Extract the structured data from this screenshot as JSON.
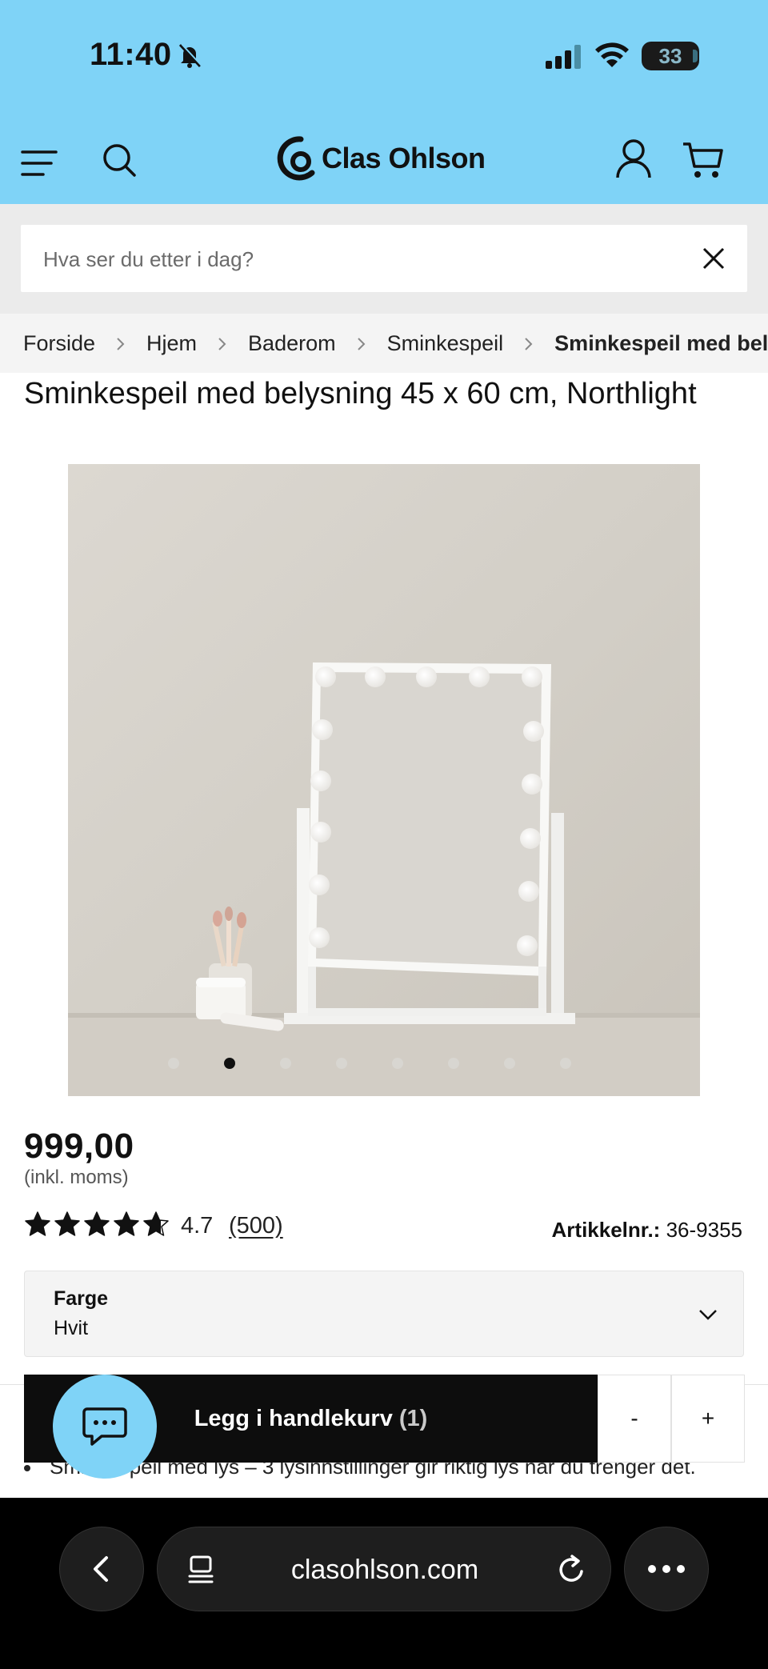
{
  "status_bar": {
    "time": "11:40",
    "battery": "33"
  },
  "header": {
    "logo_text": "Clas Ohlson",
    "background_color": "#7fd3f7"
  },
  "search": {
    "placeholder": "Hva ser du etter i dag?"
  },
  "breadcrumb": {
    "items": [
      "Forside",
      "Hjem",
      "Baderom",
      "Sminkespeil"
    ],
    "current": "Sminkespeil med belysning"
  },
  "product": {
    "title": "Sminkespeil med belysning 45 x 60 cm, Northlight",
    "image_count": 8,
    "active_image": 2,
    "price": "999,00",
    "vat_note": "(inkl. moms)",
    "rating": "4.7",
    "rating_value": 4.7,
    "reviews": "(500)",
    "article_label": "Artikkelnr.:",
    "article_number": "36-9355"
  },
  "variant": {
    "label": "Farge",
    "value": "Hvit"
  },
  "cart_bar": {
    "add_label": "Legg i handlekurv",
    "quantity": "(1)",
    "minus": "-",
    "plus": "+"
  },
  "description": {
    "bullet_1": "Sminkespeil med lys – 3 lysinnstillinger gir riktig lys når du trenger det."
  },
  "browser": {
    "url": "clasohlson.com"
  },
  "icons": [
    "menu-icon",
    "search-icon",
    "user-icon",
    "cart-icon",
    "close-icon",
    "chevron-right-icon",
    "chevron-down-icon",
    "star-icon",
    "chat-icon",
    "back-icon",
    "tabs-icon",
    "reload-icon",
    "more-icon"
  ]
}
